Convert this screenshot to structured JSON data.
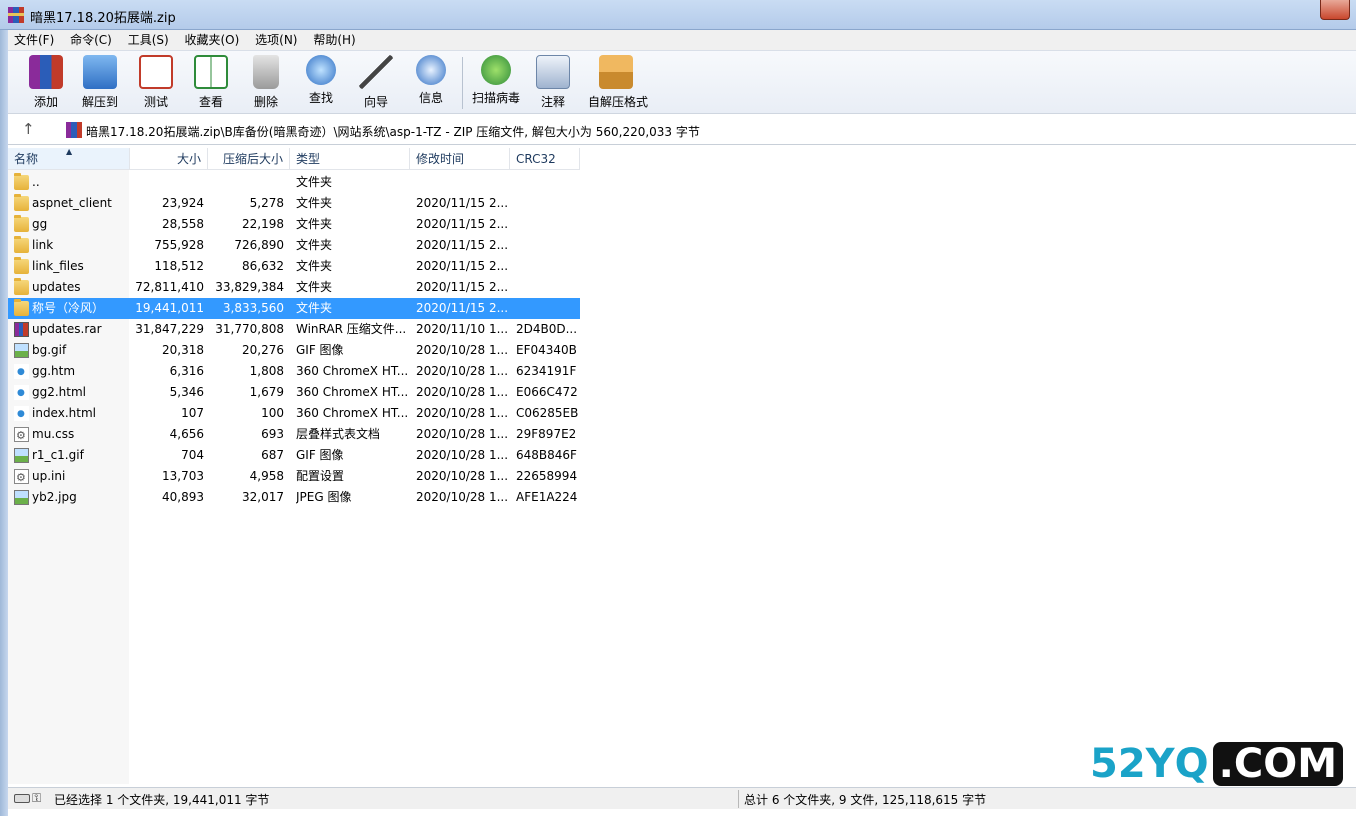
{
  "window": {
    "title": "暗黑17.18.20拓展端.zip"
  },
  "menu": [
    "文件(F)",
    "命令(C)",
    "工具(S)",
    "收藏夹(O)",
    "选项(N)",
    "帮助(H)"
  ],
  "toolbar": [
    "添加",
    "解压到",
    "测试",
    "查看",
    "删除",
    "查找",
    "向导",
    "信息",
    "扫描病毒",
    "注释",
    "自解压格式"
  ],
  "address": {
    "path": "暗黑17.18.20拓展端.zip\\B库备份(暗黑奇迹）\\网站系统\\asp-1-TZ - ZIP 压缩文件, 解包大小为 560,220,033 字节"
  },
  "columns": {
    "name": "名称",
    "size": "大小",
    "packed": "压缩后大小",
    "type": "类型",
    "mtime": "修改时间",
    "crc": "CRC32"
  },
  "files": [
    {
      "icon": "folder",
      "name": "..",
      "size": "",
      "packed": "",
      "type": "文件夹",
      "mtime": "",
      "crc": ""
    },
    {
      "icon": "folder",
      "name": "aspnet_client",
      "size": "23,924",
      "packed": "5,278",
      "type": "文件夹",
      "mtime": "2020/11/15 2...",
      "crc": ""
    },
    {
      "icon": "folder",
      "name": "gg",
      "size": "28,558",
      "packed": "22,198",
      "type": "文件夹",
      "mtime": "2020/11/15 2...",
      "crc": ""
    },
    {
      "icon": "folder",
      "name": "link",
      "size": "755,928",
      "packed": "726,890",
      "type": "文件夹",
      "mtime": "2020/11/15 2...",
      "crc": ""
    },
    {
      "icon": "folder",
      "name": "link_files",
      "size": "118,512",
      "packed": "86,632",
      "type": "文件夹",
      "mtime": "2020/11/15 2...",
      "crc": ""
    },
    {
      "icon": "folder",
      "name": "updates",
      "size": "72,811,410",
      "packed": "33,829,384",
      "type": "文件夹",
      "mtime": "2020/11/15 2...",
      "crc": ""
    },
    {
      "icon": "folder",
      "name": "称号（冷风）",
      "size": "19,441,011",
      "packed": "3,833,560",
      "type": "文件夹",
      "mtime": "2020/11/15 2...",
      "crc": "",
      "selected": true
    },
    {
      "icon": "rar",
      "name": "updates.rar",
      "size": "31,847,229",
      "packed": "31,770,808",
      "type": "WinRAR 压缩文件...",
      "mtime": "2020/11/10 1...",
      "crc": "2D4B0D..."
    },
    {
      "icon": "image",
      "name": "bg.gif",
      "size": "20,318",
      "packed": "20,276",
      "type": "GIF 图像",
      "mtime": "2020/10/28 1...",
      "crc": "EF04340B"
    },
    {
      "icon": "web",
      "name": "gg.htm",
      "size": "6,316",
      "packed": "1,808",
      "type": "360 ChromeX HT...",
      "mtime": "2020/10/28 1...",
      "crc": "6234191F"
    },
    {
      "icon": "web",
      "name": "gg2.html",
      "size": "5,346",
      "packed": "1,679",
      "type": "360 ChromeX HT...",
      "mtime": "2020/10/28 1...",
      "crc": "E066C472"
    },
    {
      "icon": "web",
      "name": "index.html",
      "size": "107",
      "packed": "100",
      "type": "360 ChromeX HT...",
      "mtime": "2020/10/28 1...",
      "crc": "C06285EB"
    },
    {
      "icon": "gear",
      "name": "mu.css",
      "size": "4,656",
      "packed": "693",
      "type": "层叠样式表文档",
      "mtime": "2020/10/28 1...",
      "crc": "29F897E2"
    },
    {
      "icon": "image",
      "name": "r1_c1.gif",
      "size": "704",
      "packed": "687",
      "type": "GIF 图像",
      "mtime": "2020/10/28 1...",
      "crc": "648B846F"
    },
    {
      "icon": "gear",
      "name": "up.ini",
      "size": "13,703",
      "packed": "4,958",
      "type": "配置设置",
      "mtime": "2020/10/28 1...",
      "crc": "22658994"
    },
    {
      "icon": "image",
      "name": "yb2.jpg",
      "size": "40,893",
      "packed": "32,017",
      "type": "JPEG 图像",
      "mtime": "2020/10/28 1...",
      "crc": "AFE1A224"
    }
  ],
  "status": {
    "left": "已经选择 1 个文件夹, 19,441,011 字节",
    "right": "总计 6 个文件夹, 9 文件, 125,118,615 字节"
  },
  "watermark": {
    "a": "52YQ",
    "b": ".COM"
  }
}
